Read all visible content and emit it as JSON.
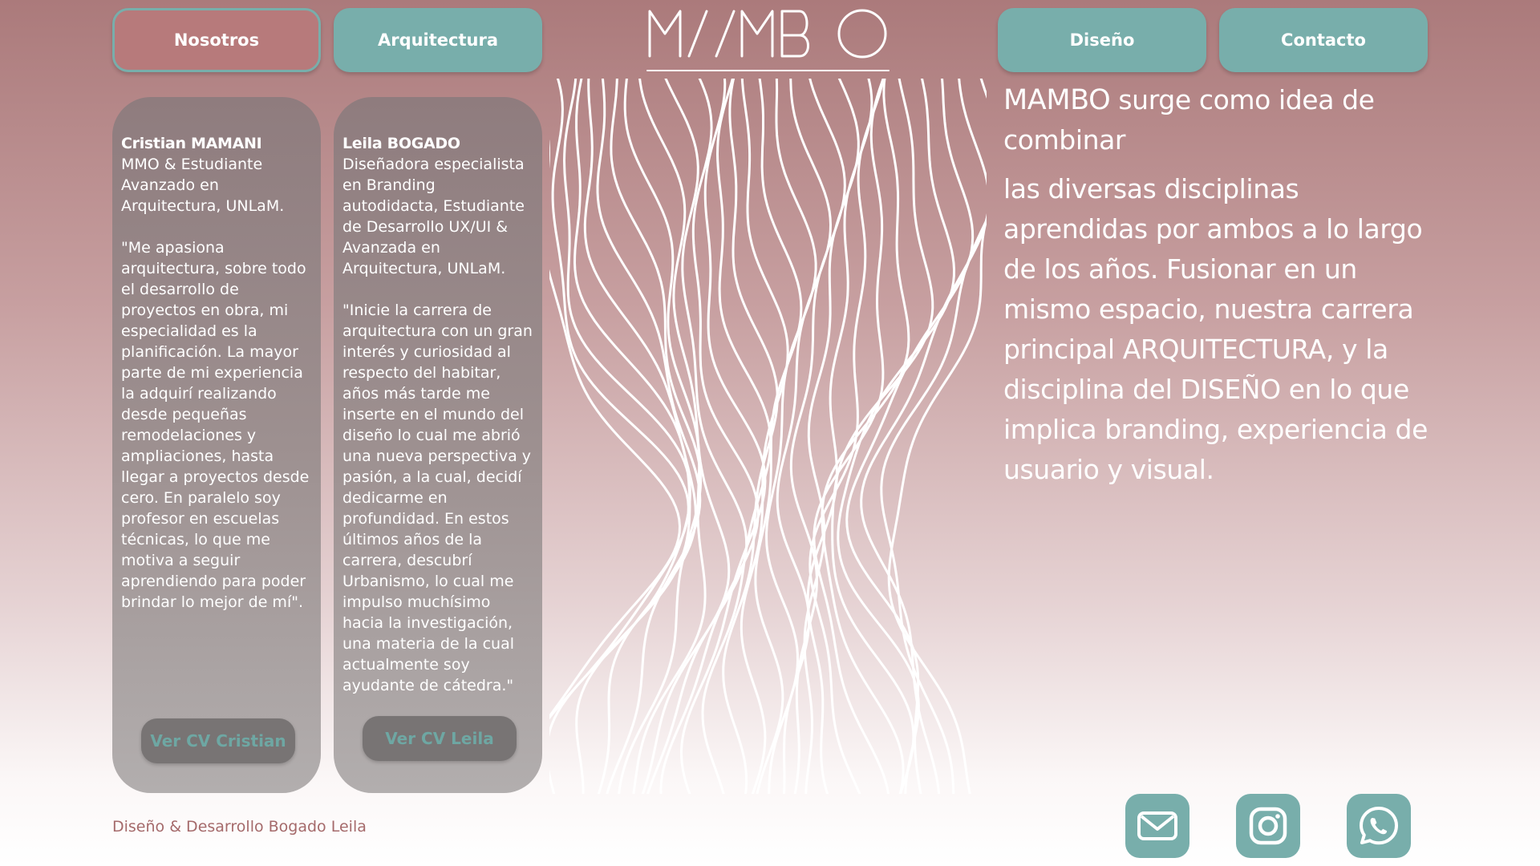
{
  "nav": {
    "nosotros": "Nosotros",
    "arquitectura": "Arquitectura",
    "diseno": "Diseño",
    "contacto": "Contacto"
  },
  "logo": {
    "text": "MAMBO"
  },
  "cards": [
    {
      "name": "Cristian MAMANI",
      "role": "MMO & Estudiante Avanzado en Arquitectura, UNLaM.",
      "quote": "\"Me apasiona arquitectura, sobre todo el desarrollo de proyectos en obra, mi especialidad es la planificación. La mayor parte de mi experiencia la adquirí realizando desde pequeñas remodelaciones y ampliaciones, hasta llegar a proyectos desde cero. En paralelo soy profesor en escuelas técnicas, lo que me motiva a seguir aprendiendo para poder brindar lo mejor de mí\".",
      "cv_label": "Ver CV Cristian"
    },
    {
      "name": "Leila BOGADO",
      "role": "Diseñadora especialista en Branding autodidacta, Estudiante de Desarrollo UX/UI & Avanzada en Arquitectura, UNLaM.",
      "quote": "\"Inicie la carrera de arquitectura con un gran interés y curiosidad al respecto del habitar, años más tarde me inserte en el mundo del diseño lo cual me abrió una nueva perspectiva y pasión, a la cual, decidí dedicarme en profundidad. En estos últimos años de la carrera, descubrí Urbanismo, lo cual me impulso muchísimo hacia la investigación, una materia de la cual actualmente soy ayudante de cátedra.\"",
      "cv_label": "Ver CV Leila"
    }
  ],
  "about": {
    "brand": "MAMBO",
    "line1": " surge como idea de combinar",
    "paragraph2": "las diversas disciplinas aprendidas por ambos a lo largo de los años. Fusionar en un mismo espacio, nuestra carrera principal ARQUITECTURA, y la disciplina del DISEÑO en lo que implica branding, experiencia de usuario y visual."
  },
  "footer": {
    "credit": "Diseño & Desarrollo Bogado Leila"
  },
  "social": [
    "mail-icon",
    "instagram-icon",
    "whatsapp-icon"
  ],
  "colors": {
    "teal": "#78aeab",
    "rose": "#b77a7b",
    "card": "#9d9090"
  }
}
